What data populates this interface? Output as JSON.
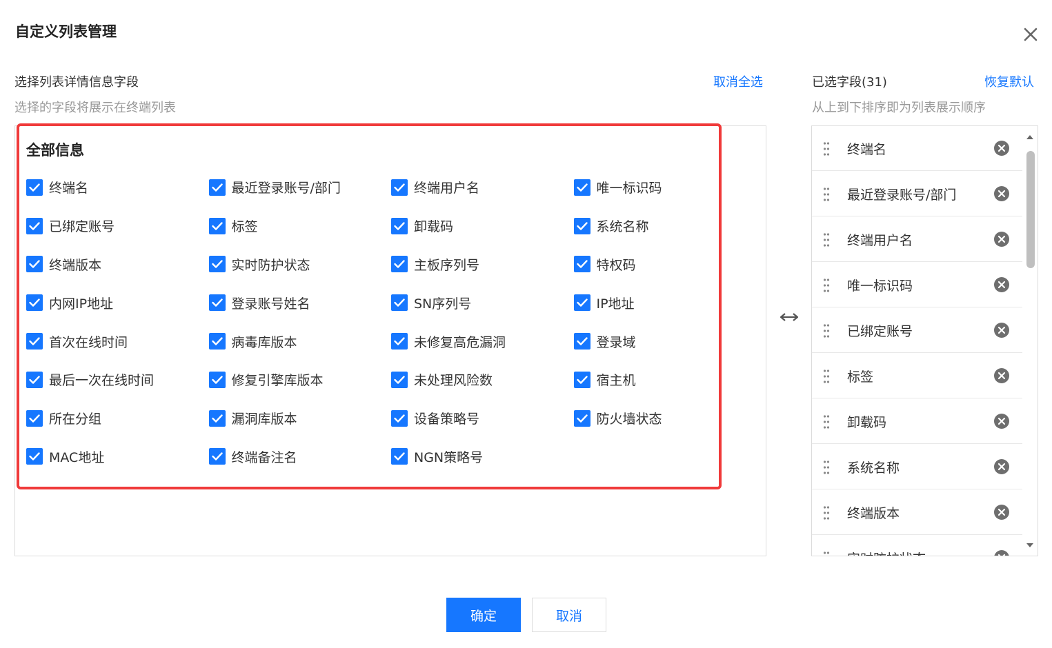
{
  "dialog": {
    "title": "自定义列表管理"
  },
  "left": {
    "title": "选择列表详情信息字段",
    "subtitle": "选择的字段将展示在终端列表",
    "deselect_all": "取消全选",
    "group_title": "全部信息",
    "fields": [
      {
        "label": "终端名",
        "checked": true
      },
      {
        "label": "最近登录账号/部门",
        "checked": true
      },
      {
        "label": "终端用户名",
        "checked": true
      },
      {
        "label": "唯一标识码",
        "checked": true
      },
      {
        "label": "已绑定账号",
        "checked": true
      },
      {
        "label": "标签",
        "checked": true
      },
      {
        "label": "卸载码",
        "checked": true
      },
      {
        "label": "系统名称",
        "checked": true
      },
      {
        "label": "终端版本",
        "checked": true
      },
      {
        "label": "实时防护状态",
        "checked": true
      },
      {
        "label": "主板序列号",
        "checked": true
      },
      {
        "label": "特权码",
        "checked": true
      },
      {
        "label": "内网IP地址",
        "checked": true
      },
      {
        "label": "登录账号姓名",
        "checked": true
      },
      {
        "label": "SN序列号",
        "checked": true
      },
      {
        "label": "IP地址",
        "checked": true
      },
      {
        "label": "首次在线时间",
        "checked": true
      },
      {
        "label": "病毒库版本",
        "checked": true
      },
      {
        "label": "未修复高危漏洞",
        "checked": true
      },
      {
        "label": "登录域",
        "checked": true
      },
      {
        "label": "最后一次在线时间",
        "checked": true
      },
      {
        "label": "修复引擎库版本",
        "checked": true
      },
      {
        "label": "未处理风险数",
        "checked": true
      },
      {
        "label": "宿主机",
        "checked": true
      },
      {
        "label": "所在分组",
        "checked": true
      },
      {
        "label": "漏洞库版本",
        "checked": true
      },
      {
        "label": "设备策略号",
        "checked": true
      },
      {
        "label": "防火墙状态",
        "checked": true
      },
      {
        "label": "MAC地址",
        "checked": true
      },
      {
        "label": "终端备注名",
        "checked": true
      },
      {
        "label": "NGN策略号",
        "checked": true
      }
    ]
  },
  "right": {
    "title": "已选字段(31)",
    "subtitle": "从上到下排序即为列表展示顺序",
    "restore_default": "恢复默认",
    "selected": [
      "终端名",
      "最近登录账号/部门",
      "终端用户名",
      "唯一标识码",
      "已绑定账号",
      "标签",
      "卸载码",
      "系统名称",
      "终端版本",
      "实时防护状态"
    ]
  },
  "footer": {
    "confirm": "确定",
    "cancel": "取消"
  },
  "colors": {
    "primary": "#1677ff",
    "highlight": "#f03a3a"
  },
  "icons": {
    "close": "close-icon",
    "checkbox": "check-icon",
    "transfer": "swap-horizontal-icon",
    "drag": "drag-handle-icon",
    "remove": "remove-circle-icon"
  }
}
